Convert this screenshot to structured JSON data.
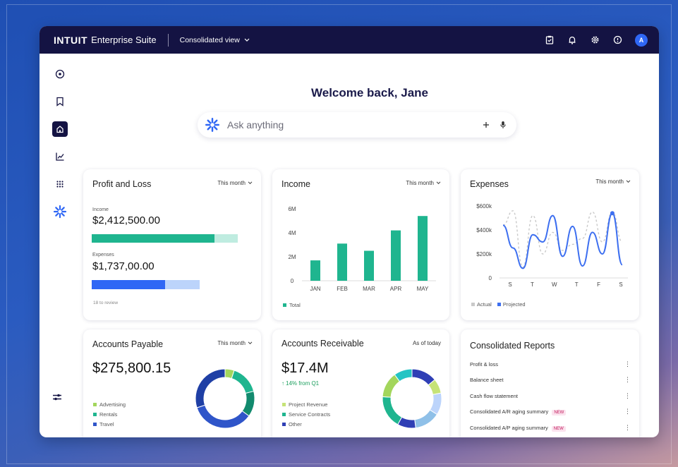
{
  "topbar": {
    "brand": "INTUIT",
    "suite": "Enterprise Suite",
    "view_label": "Consolidated view",
    "avatar_initial": "A"
  },
  "welcome": "Welcome back, Jane",
  "search": {
    "placeholder": "Ask anything"
  },
  "profit_loss": {
    "title": "Profit and Loss",
    "filter": "This month",
    "income_label": "Income",
    "income_value": "$2,412,500.00",
    "income_fill": 0.84,
    "expenses_label": "Expenses",
    "expenses_value": "$1,737,00.00",
    "expenses_fill": 0.68,
    "review_text": "18 to review",
    "colors": {
      "income": "#1fb58f",
      "income_rest": "#bfece0",
      "expenses": "#2f67f5",
      "expenses_rest": "#bcd4fb"
    }
  },
  "income": {
    "title": "Income",
    "filter": "This month",
    "legend": "Total",
    "color": "#1fb58f"
  },
  "expenses": {
    "title": "Expenses",
    "filter": "This month",
    "legend_actual": "Actual",
    "legend_projected": "Projected",
    "color_line": "#3d6ff0",
    "color_dashed": "#c9c9c9"
  },
  "accounts_payable": {
    "title": "Accounts Payable",
    "filter": "This month",
    "value": "$275,800.15",
    "legend": [
      {
        "label": "Advertising",
        "color": "#a3d65c"
      },
      {
        "label": "Rentals",
        "color": "#1fb58f"
      },
      {
        "label": "Travel",
        "color": "#2f55c9"
      }
    ]
  },
  "accounts_receivable": {
    "title": "Accounts Receivable",
    "filter": "As of today",
    "value": "$17.4M",
    "change": "14% from Q1",
    "change_color": "#1a9e5c",
    "legend": [
      {
        "label": "Project Revenue",
        "color": "#c6e377"
      },
      {
        "label": "Service Contracts",
        "color": "#1fb58f"
      },
      {
        "label": "Other",
        "color": "#2f3fb5"
      }
    ]
  },
  "reports": {
    "title": "Consolidated Reports",
    "items": [
      {
        "label": "Profit & loss",
        "badge": ""
      },
      {
        "label": "Balance sheet",
        "badge": ""
      },
      {
        "label": "Cash flow statement",
        "badge": ""
      },
      {
        "label": "Consolidated A/R aging summary",
        "badge": "NEW"
      },
      {
        "label": "Consolidated A/P aging summary",
        "badge": "NEW"
      }
    ]
  },
  "chart_data": [
    {
      "type": "bar",
      "categories": [
        "JAN",
        "FEB",
        "MAR",
        "APR",
        "MAY"
      ],
      "series": [
        {
          "name": "Total",
          "values": [
            1.7,
            3.1,
            2.5,
            4.2,
            5.4
          ]
        }
      ],
      "ytick_labels": [
        "0",
        "2M",
        "4M",
        "6M"
      ],
      "ylim": [
        0,
        6
      ]
    },
    {
      "type": "line",
      "x": [
        "S",
        "T",
        "W",
        "T",
        "F",
        "S"
      ],
      "series": [
        {
          "name": "Actual",
          "values": [
            440,
            250,
            80,
            360,
            300,
            520,
            180,
            430,
            100,
            380,
            200,
            540,
            110
          ]
        },
        {
          "name": "Projected",
          "values": [
            440,
            560,
            90,
            520,
            200,
            380,
            230,
            280,
            330,
            550,
            300,
            550,
            300
          ]
        }
      ],
      "ytick_labels": [
        "0",
        "$200k",
        "$400k",
        "$600k"
      ],
      "ylim": [
        0,
        600
      ]
    },
    {
      "type": "pie",
      "title": "Accounts Payable",
      "labels": [
        "Advertising",
        "Rentals",
        "Travel"
      ],
      "values": [
        5,
        30,
        65
      ]
    },
    {
      "type": "pie",
      "title": "Accounts Receivable",
      "labels": [
        "Project Revenue",
        "Service Contracts",
        "Other"
      ],
      "values": [
        35,
        30,
        35
      ]
    }
  ]
}
